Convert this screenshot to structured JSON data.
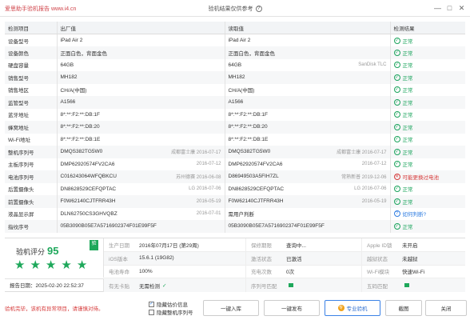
{
  "window": {
    "app_title": "爱思助手验机报告 www.i4.cn",
    "center_title": "验机结果仅供参考",
    "help_icon": "?",
    "minimize": "—",
    "maximize": "□",
    "close": "✕"
  },
  "table": {
    "headers": [
      "检测项目",
      "出厂值",
      "读取值",
      "检测结果"
    ],
    "rows": [
      {
        "item": "设备型号",
        "factory": "iPad Air 2",
        "factory_aux": "",
        "read": "iPad Air 2",
        "read_aux": "",
        "result": "正常",
        "status": "ok"
      },
      {
        "item": "设备颜色",
        "factory": "正面白色，背面金色",
        "factory_aux": "",
        "read": "正面白色，背面金色",
        "read_aux": "",
        "result": "正常",
        "status": "ok"
      },
      {
        "item": "硬盘容量",
        "factory": "64GB",
        "factory_aux": "",
        "read": "64GB",
        "read_aux": "SanDisk TLC",
        "result": "正常",
        "status": "ok"
      },
      {
        "item": "销售型号",
        "factory": "MH182",
        "factory_aux": "",
        "read": "MH182",
        "read_aux": "",
        "result": "正常",
        "status": "ok"
      },
      {
        "item": "销售地区",
        "factory": "CH/A(中国)",
        "factory_aux": "",
        "read": "CH/A(中国)",
        "read_aux": "",
        "result": "正常",
        "status": "ok"
      },
      {
        "item": "监管型号",
        "factory": "A1566",
        "factory_aux": "",
        "read": "A1566",
        "read_aux": "",
        "result": "正常",
        "status": "ok"
      },
      {
        "item": "蓝牙地址",
        "factory": "8*:**:F2:**:DB:1F",
        "factory_aux": "",
        "read": "8*:**:F2:**:DB:1F",
        "read_aux": "",
        "result": "正常",
        "status": "ok"
      },
      {
        "item": "蜂窝地址",
        "factory": "8*:**:F2:**:DB:20",
        "factory_aux": "",
        "read": "8*:**:F2:**:DB:20",
        "read_aux": "",
        "result": "正常",
        "status": "ok"
      },
      {
        "item": "Wi-Fi地址",
        "factory": "8*:**:F2:**:DB:1E",
        "factory_aux": "",
        "read": "8*:**:F2:**:DB:1E",
        "read_aux": "",
        "result": "正常",
        "status": "ok"
      },
      {
        "item": "整机序列号",
        "factory": "DMQS382TG5W0",
        "factory_aux": "成都富士康 2016-07-17",
        "read": "DMQS382TG5W0",
        "read_aux": "成都富士康 2016-07-17",
        "result": "正常",
        "status": "ok"
      },
      {
        "item": "主板序列号",
        "factory": "DMP62920574FV2CA6",
        "factory_aux": "2016-07-12",
        "read": "DMP62920574FV2CA6",
        "read_aux": "2016-07-12",
        "result": "正常",
        "status": "ok"
      },
      {
        "item": "电池序列号",
        "factory": "C016243064WFQBKCU",
        "factory_aux": "苏州德赛 2016-06-08",
        "read": "D86949503A5FIH7ZL",
        "read_aux": "常熟新普 2019-12-06",
        "result": "可能更换过电池",
        "status": "warn"
      },
      {
        "item": "后置摄像头",
        "factory": "DN8628529CEFQPTAC",
        "factory_aux": "LG 2016-07-06",
        "read": "DN8628529CEFQPTAC",
        "read_aux": "LG 2016-07-06",
        "result": "正常",
        "status": "ok"
      },
      {
        "item": "前置摄像头",
        "factory": "F0W62140CJTFRR43H",
        "factory_aux": "2016-05-19",
        "read": "F0W62140CJTFRR43H",
        "read_aux": "2016-05-19",
        "result": "正常",
        "status": "ok"
      },
      {
        "item": "液晶显示屏",
        "factory": "DLN62750CS3GHVQBZ",
        "factory_aux": "2016-07-01",
        "read": "需用户判断",
        "read_aux": "",
        "result": "如何判断?",
        "status": "info"
      },
      {
        "item": "指纹序号",
        "factory": "05B3090B05E7A5716902374F01E99F5F",
        "factory_aux": "",
        "read": "05B3090B05E7A5716902374F01E99F5F",
        "read_aux": "",
        "result": "正常",
        "status": "ok"
      }
    ]
  },
  "summary": {
    "score_label": "验机评分",
    "score": "95",
    "badge": "验",
    "stars": [
      "★",
      "★",
      "★",
      "★",
      "★"
    ],
    "report_date_label": "报告日期：",
    "report_date": "2025-02-20 22:52:37",
    "grid": [
      [
        {
          "k": "生产日期",
          "v": "2016年07月17日 (第29周)"
        },
        {
          "k": "保修期限",
          "v": "查询中..."
        },
        {
          "k": "Apple ID锁",
          "v": "未开启"
        }
      ],
      [
        {
          "k": "iOS版本",
          "v": "15.6.1 (19G82)"
        },
        {
          "k": "激活状态",
          "v": "已激活"
        },
        {
          "k": "越狱状态",
          "v": "未越狱"
        }
      ],
      [
        {
          "k": "电池寿命",
          "v": "100%"
        },
        {
          "k": "充电次数",
          "v": "0次"
        },
        {
          "k": "Wi-Fi模块",
          "v": "快速Wi-Fi"
        }
      ],
      [
        {
          "k": "有无卡贴",
          "v": "无需检测"
        },
        {
          "k": "序列号匹配",
          "v": ""
        },
        {
          "k": "五码匹配",
          "v": ""
        }
      ]
    ]
  },
  "footer": {
    "note": "验机完毕，该机有异常项目，请谨慎对待。",
    "checkbox_hide_valuation": "隐藏估价信息",
    "checkbox_hide_serial": "隐藏整机序列号",
    "btn_import": "一键入库",
    "btn_publish": "一键发布",
    "btn_pro": "专业验机",
    "btn_screenshot": "截图",
    "btn_close": "关闭",
    "pro_icon": "专"
  },
  "colors": {
    "ok": "#19a35b",
    "warn": "#d63b3b",
    "info": "#2f7de1",
    "accent": "#d0454b"
  }
}
